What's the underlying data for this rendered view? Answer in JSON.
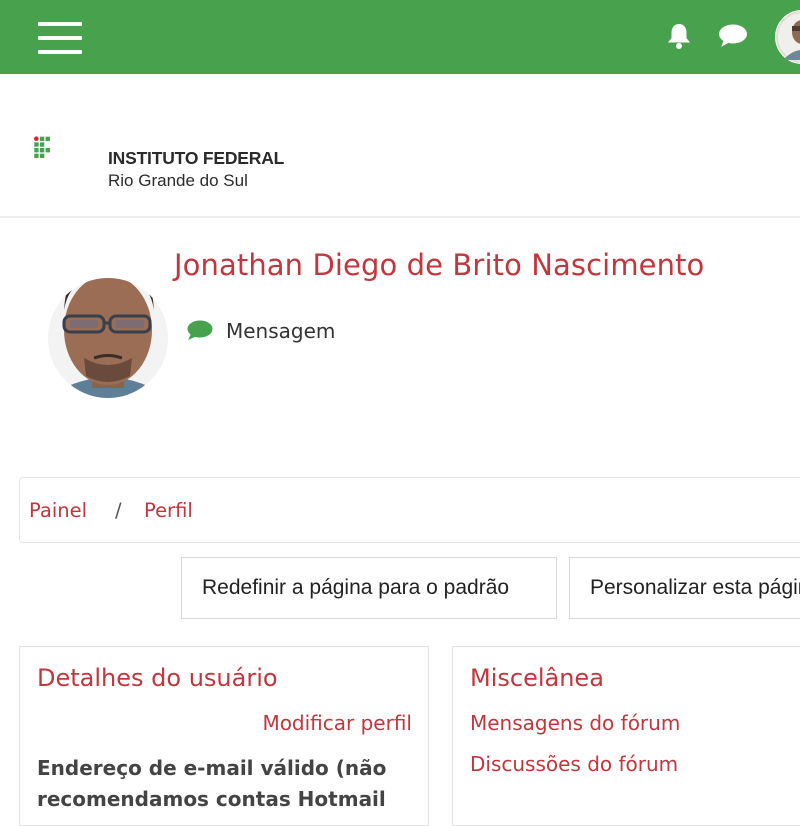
{
  "navbar": {
    "menu_icon": "hamburger-menu-icon",
    "notifications_icon": "bell-icon",
    "messages_icon": "chat-bubble-icon",
    "avatar": "user-avatar"
  },
  "header": {
    "logo_line1": "INSTITUTO FEDERAL",
    "logo_line2": "Rio Grande do Sul"
  },
  "profile": {
    "name": "Jonathan Diego de Brito Nascimento",
    "message_label": "Mensagem",
    "message_icon": "comment-icon"
  },
  "breadcrumb": {
    "items": [
      "Painel",
      "Perfil"
    ],
    "separator": "/"
  },
  "actions": {
    "reset_label": "Redefinir a página para o padrão",
    "customize_label": "Personalizar esta página"
  },
  "user_details": {
    "title": "Detalhes do usuário",
    "edit_link": "Modificar perfil",
    "email_note_line1": "Endereço de e-mail válido (não",
    "email_note_line2": "recomendamos contas Hotmail"
  },
  "misc": {
    "title": "Miscelânea",
    "links": [
      "Mensagens do fórum",
      "Discussões do fórum"
    ]
  },
  "colors": {
    "brand_green": "#48a14d",
    "link_red": "#c2363d",
    "logo_red": "#d7272c"
  }
}
